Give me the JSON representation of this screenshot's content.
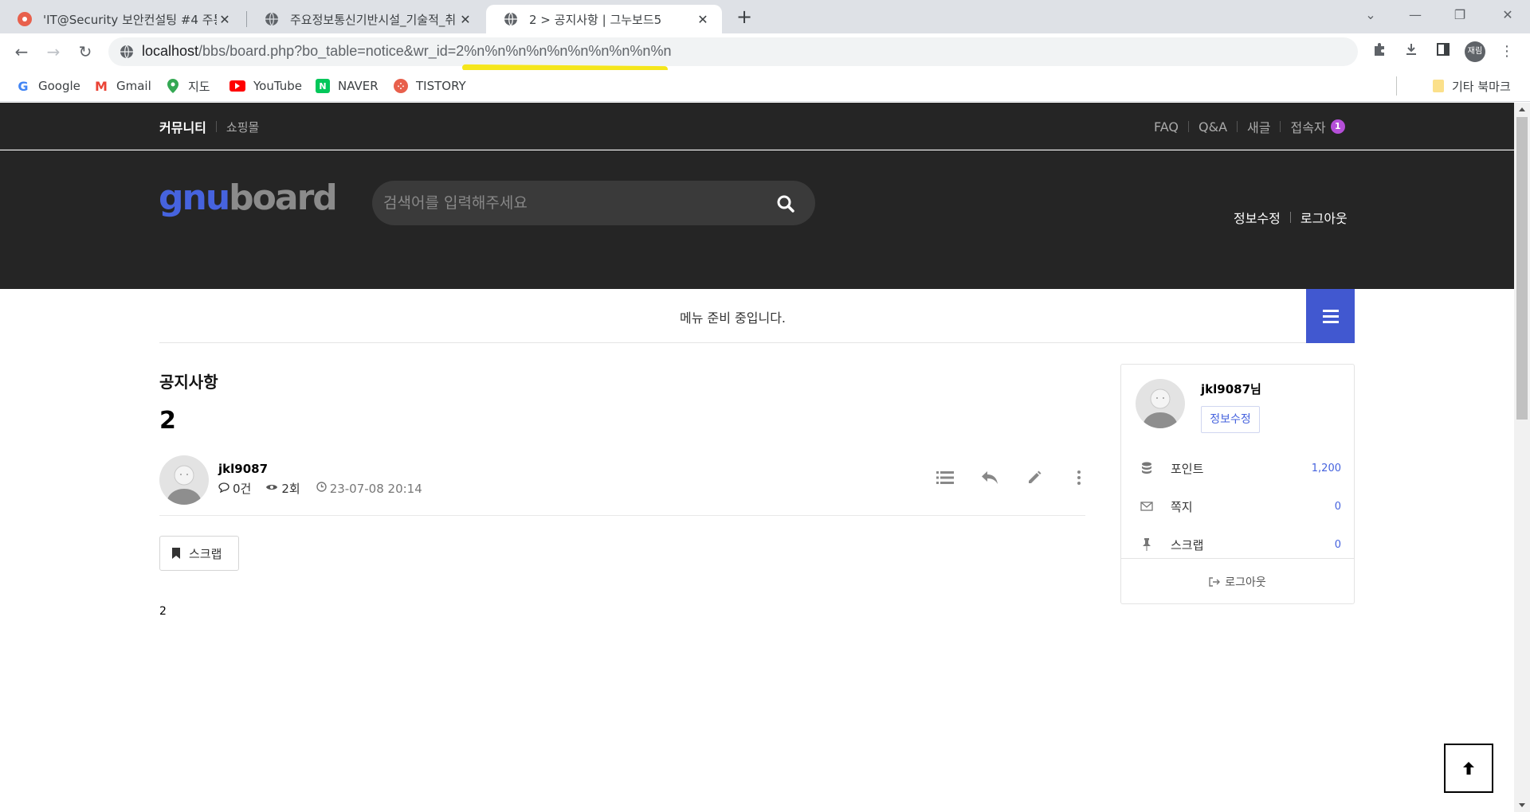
{
  "browser": {
    "tabs": [
      {
        "title": "'IT@Security 보안컨설팅 #4 주통",
        "active": false
      },
      {
        "title": "주요정보통신기반시설_기술적_취",
        "active": false
      },
      {
        "title": "2 > 공지사항 | 그누보드5",
        "active": true
      }
    ],
    "url_host": "localhost",
    "url_path": "/bbs/board.php?bo_table=notice&wr_id=2%n%n%n%n%n%n%n%n%n%n",
    "profile_label": "재림",
    "bookmarks": [
      "Google",
      "Gmail",
      "지도",
      "YouTube",
      "NAVER",
      "TISTORY"
    ],
    "other_bookmarks": "기타 북마크"
  },
  "topnav": {
    "community": "커뮤니티",
    "shop": "쇼핑몰",
    "links": [
      "FAQ",
      "Q&A",
      "새글",
      "접속자"
    ],
    "visitor_count": "1"
  },
  "header": {
    "logo_part1": "gnu",
    "logo_part2": "board",
    "search_placeholder": "검색어를 입력해주세요",
    "edit_profile": "정보수정",
    "logout": "로그아웃"
  },
  "menu": {
    "message": "메뉴 준비 중입니다."
  },
  "board": {
    "title": "공지사항",
    "post_title": "2",
    "writer": "jkl9087",
    "comments": "0건",
    "views": "2회",
    "date": "23-07-08 20:14",
    "scrap_label": "스크랩",
    "content": "2"
  },
  "sidebar": {
    "username": "jkl9087님",
    "edit_label": "정보수정",
    "rows": [
      {
        "label": "포인트",
        "value": "1,200"
      },
      {
        "label": "쪽지",
        "value": "0"
      },
      {
        "label": "스크랩",
        "value": "0"
      }
    ],
    "logout_label": "로그아웃"
  },
  "colors": {
    "accent": "#4158d0",
    "badge": "#b54fd8",
    "header_bg": "#252525",
    "url_highlight": "#f5e61b"
  }
}
